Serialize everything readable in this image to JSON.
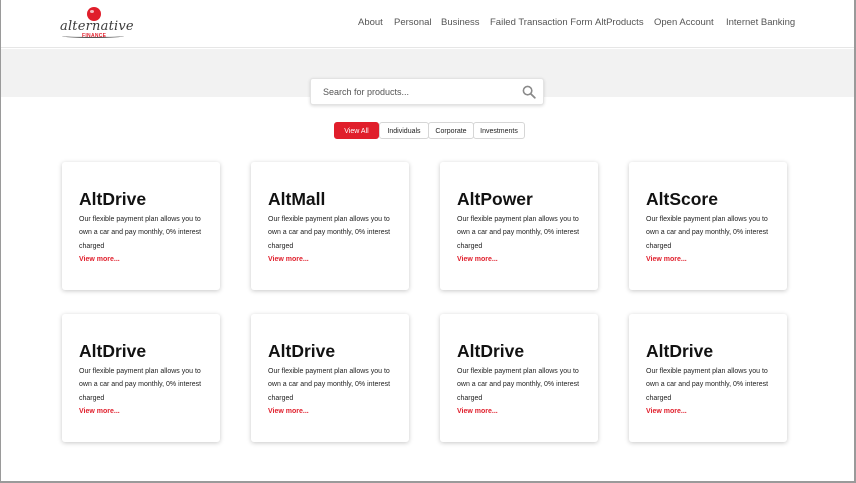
{
  "brand": {
    "logo_text": "alternative",
    "logo_subtext": "FINANCE",
    "accent_color": "#e01e2b"
  },
  "nav": {
    "items": [
      "About",
      "Personal",
      "Business",
      "Failed Transaction Form",
      "AltProducts",
      "Open Account",
      "Internet Banking"
    ]
  },
  "search": {
    "placeholder": "Search for products...",
    "value": "",
    "icon": "search-icon"
  },
  "filters": {
    "items": [
      "View All",
      "Individuals",
      "Corporate",
      "Investments"
    ],
    "active": "View All"
  },
  "products": [
    {
      "title": "AltDrive",
      "description": "Our flexible payment plan allows you to own a car and pay monthly, 0% interest charged",
      "link": "View more..."
    },
    {
      "title": "AltMall",
      "description": "Our flexible payment plan allows you to own a car and pay monthly, 0% interest charged",
      "link": "View more..."
    },
    {
      "title": "AltPower",
      "description": "Our flexible payment plan allows you to own a car and pay monthly, 0% interest charged",
      "link": "View more..."
    },
    {
      "title": "AltScore",
      "description": "Our flexible payment plan allows you to own a car and pay monthly, 0% interest charged",
      "link": "View more..."
    },
    {
      "title": "AltDrive",
      "description": "Our flexible payment plan allows you to own a car and pay monthly, 0% interest charged",
      "link": "View more..."
    },
    {
      "title": "AltDrive",
      "description": "Our flexible payment plan allows you to own a car and pay monthly, 0% interest charged",
      "link": "View more..."
    },
    {
      "title": "AltDrive",
      "description": "Our flexible payment plan allows you to own a car and pay monthly, 0% interest charged",
      "link": "View more..."
    },
    {
      "title": "AltDrive",
      "description": "Our flexible payment plan allows you to own a car and pay monthly, 0% interest charged",
      "link": "View more..."
    }
  ]
}
